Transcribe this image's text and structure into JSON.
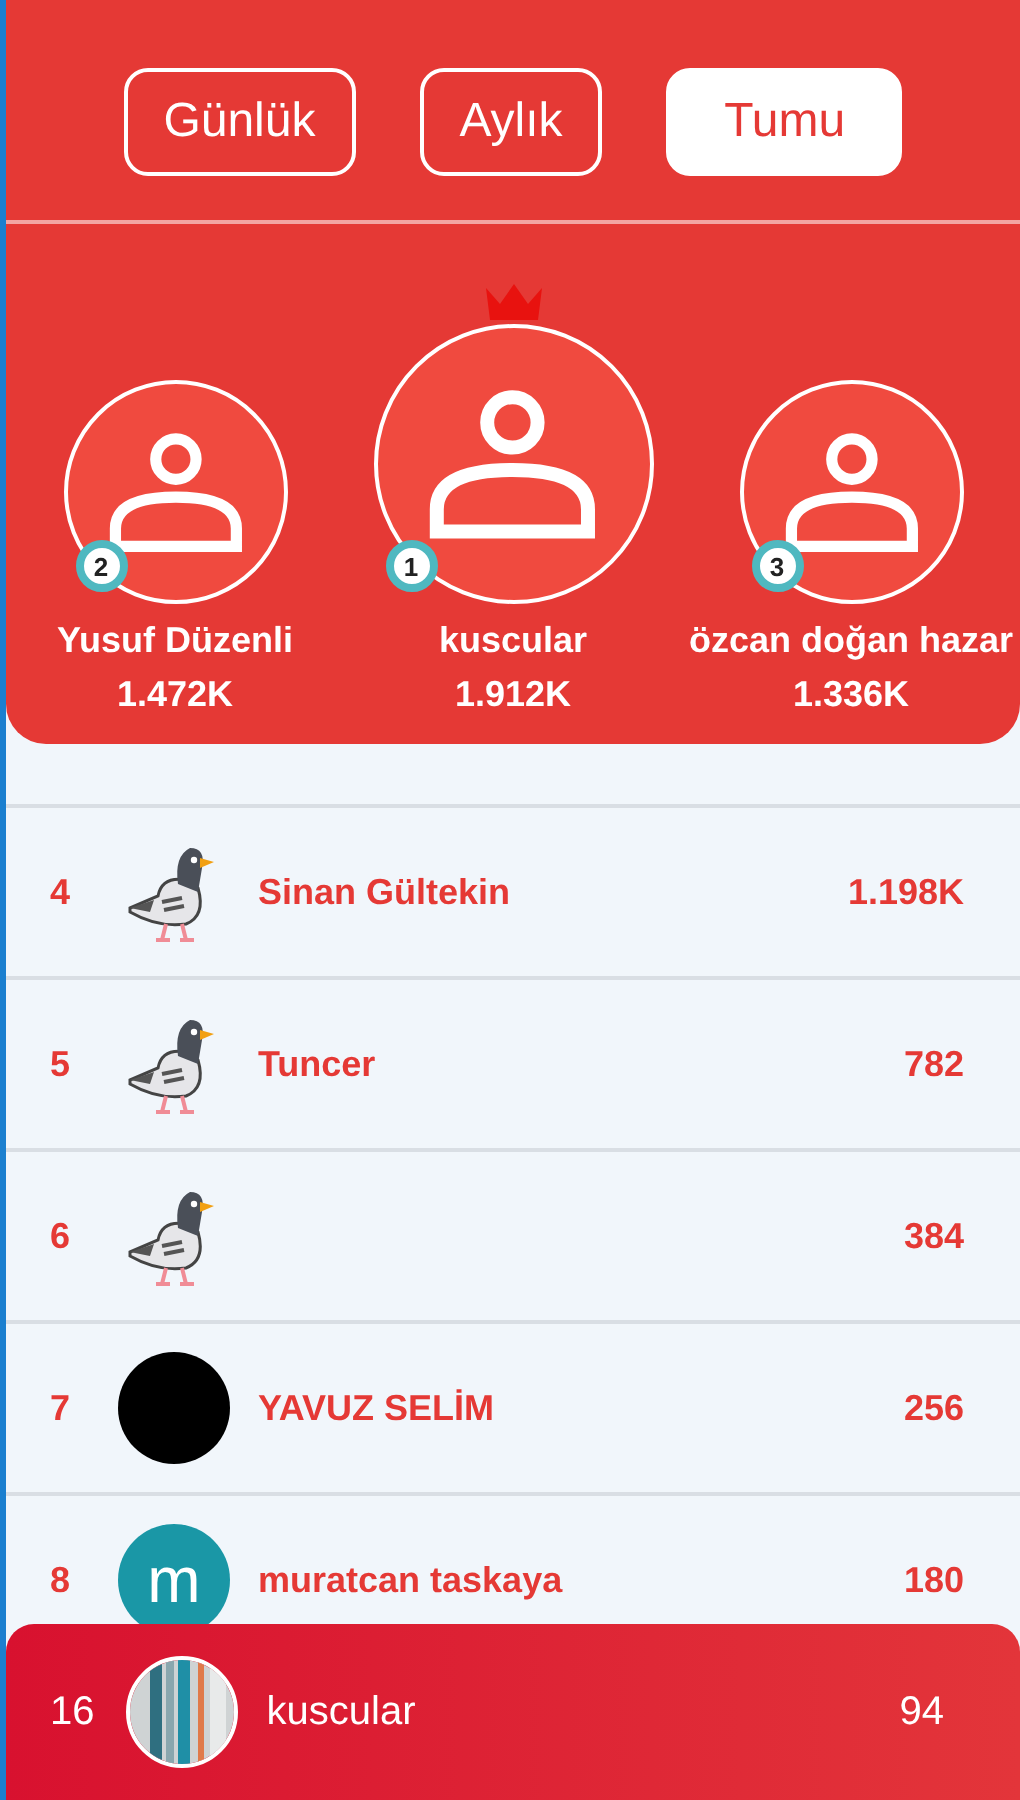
{
  "tabs": [
    {
      "label": "Günlük",
      "selected": false
    },
    {
      "label": "Aylık",
      "selected": false
    },
    {
      "label": "Tumu",
      "selected": true
    }
  ],
  "podium": [
    {
      "medal": "2",
      "name": "Yusuf Düzenli",
      "score": "1.472K",
      "crown": false
    },
    {
      "medal": "1",
      "name": "kuscular",
      "score": "1.912K",
      "crown": true
    },
    {
      "medal": "3",
      "name": "özcan doğan hazar",
      "score": "1.336K",
      "crown": false
    }
  ],
  "rows": [
    {
      "rank": "4",
      "avatar": {
        "kind": "pigeon"
      },
      "name": "Sinan Gültekin",
      "score": "1.198K"
    },
    {
      "rank": "5",
      "avatar": {
        "kind": "pigeon"
      },
      "name": "Tuncer",
      "score": "782"
    },
    {
      "rank": "6",
      "avatar": {
        "kind": "pigeon"
      },
      "score": "384"
    },
    {
      "rank": "7",
      "avatar": {
        "kind": "plain",
        "color": "#000000"
      },
      "name": "YAVUZ SELİM",
      "score": "256"
    },
    {
      "rank": "8",
      "avatar": {
        "kind": "letter",
        "letter": "m",
        "color": "#1a97a6"
      },
      "name": "muratcan taskaya",
      "score": "180"
    }
  ],
  "my_rank": {
    "rank": "16",
    "name": "kuscular",
    "score": "94"
  }
}
